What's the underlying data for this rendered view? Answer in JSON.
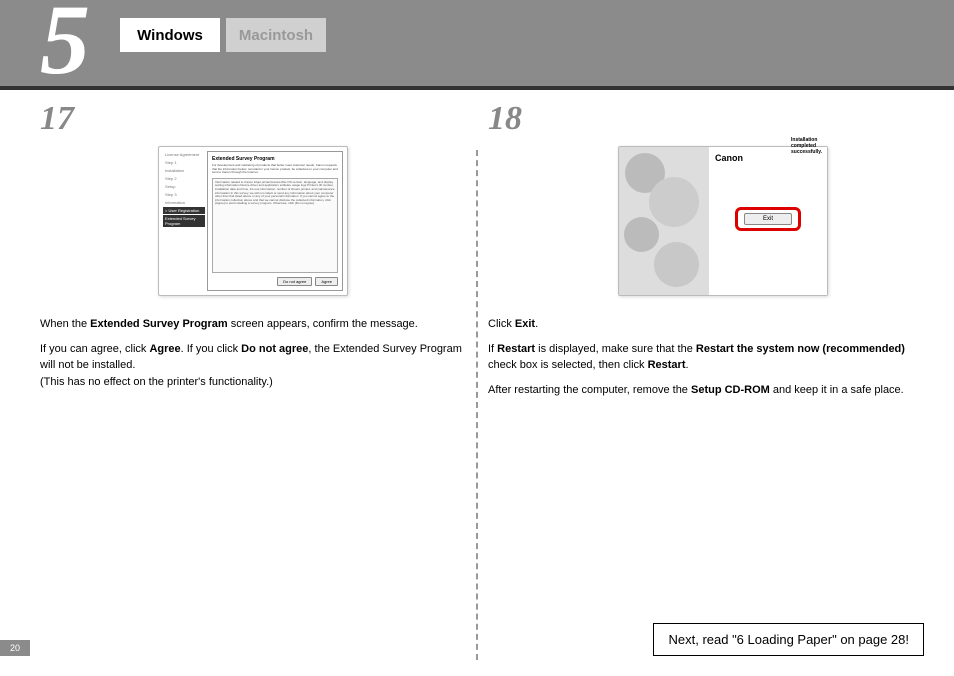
{
  "header": {
    "section_number": "5",
    "tabs": {
      "active": "Windows",
      "inactive": "Macintosh"
    }
  },
  "steps": {
    "s17": {
      "number": "17",
      "screenshot": {
        "sidebar": {
          "items": [
            "License Agreement",
            "Step 1",
            "Installation",
            "Step 2",
            "Setup",
            "Step 3",
            "Information"
          ],
          "highlighted": [
            "> User Registration",
            "Extended Survey Program"
          ]
        },
        "title": "Extended Survey Program",
        "desc": "For development and marketing of products that better meet customer needs, Canon requests that the information below, recorded in your Canon product, be collected on your computer and sent to Canon through the Internet.",
        "scrollbox": "Information related to Canon inkjet printer/scanner/fax\nOS version, language, and display setting information\nDevice driver and application software usage logs\nPrinter's ID number, installation date and time, ink use information, number of sheets printed, and maintenance information\n\nIn this survey, we will not collect or send any information about your computer other than that listed above or any of your personal information.\n\nIf you cannot agree to the information collection above and that we cannot disclose the collected information, click [Agree] to start installing a survey program. Otherwise, click [Do not agree].",
        "button_disagree": "Do not agree",
        "button_agree": "Agree"
      },
      "text1a": "When the ",
      "text1b": "Extended Survey Program",
      "text1c": " screen appears, confirm the message.",
      "text2a": "If you can agree, click ",
      "text2b": "Agree",
      "text2c": ". If you click ",
      "text2d": "Do not agree",
      "text2e": ", the Extended Survey Program will not be installed.",
      "text3": "(This has no effect on the printer's functionality.)"
    },
    "s18": {
      "number": "18",
      "screenshot": {
        "brand": "Canon",
        "message": "Installation completed successfully.",
        "exit_button": "Exit"
      },
      "text1a": "Click ",
      "text1b": "Exit",
      "text1c": ".",
      "text2a": "If ",
      "text2b": "Restart",
      "text2c": " is displayed, make sure that the ",
      "text2d": "Restart the system now (recommended)",
      "text2e": " check box is selected, then click ",
      "text2f": "Restart",
      "text2g": ".",
      "text3a": "After restarting the computer, remove the ",
      "text3b": "Setup CD-ROM",
      "text3c": " and keep it in a safe place."
    }
  },
  "next_box": "Next, read \"6 Loading Paper\" on page 28!",
  "page_number": "20"
}
